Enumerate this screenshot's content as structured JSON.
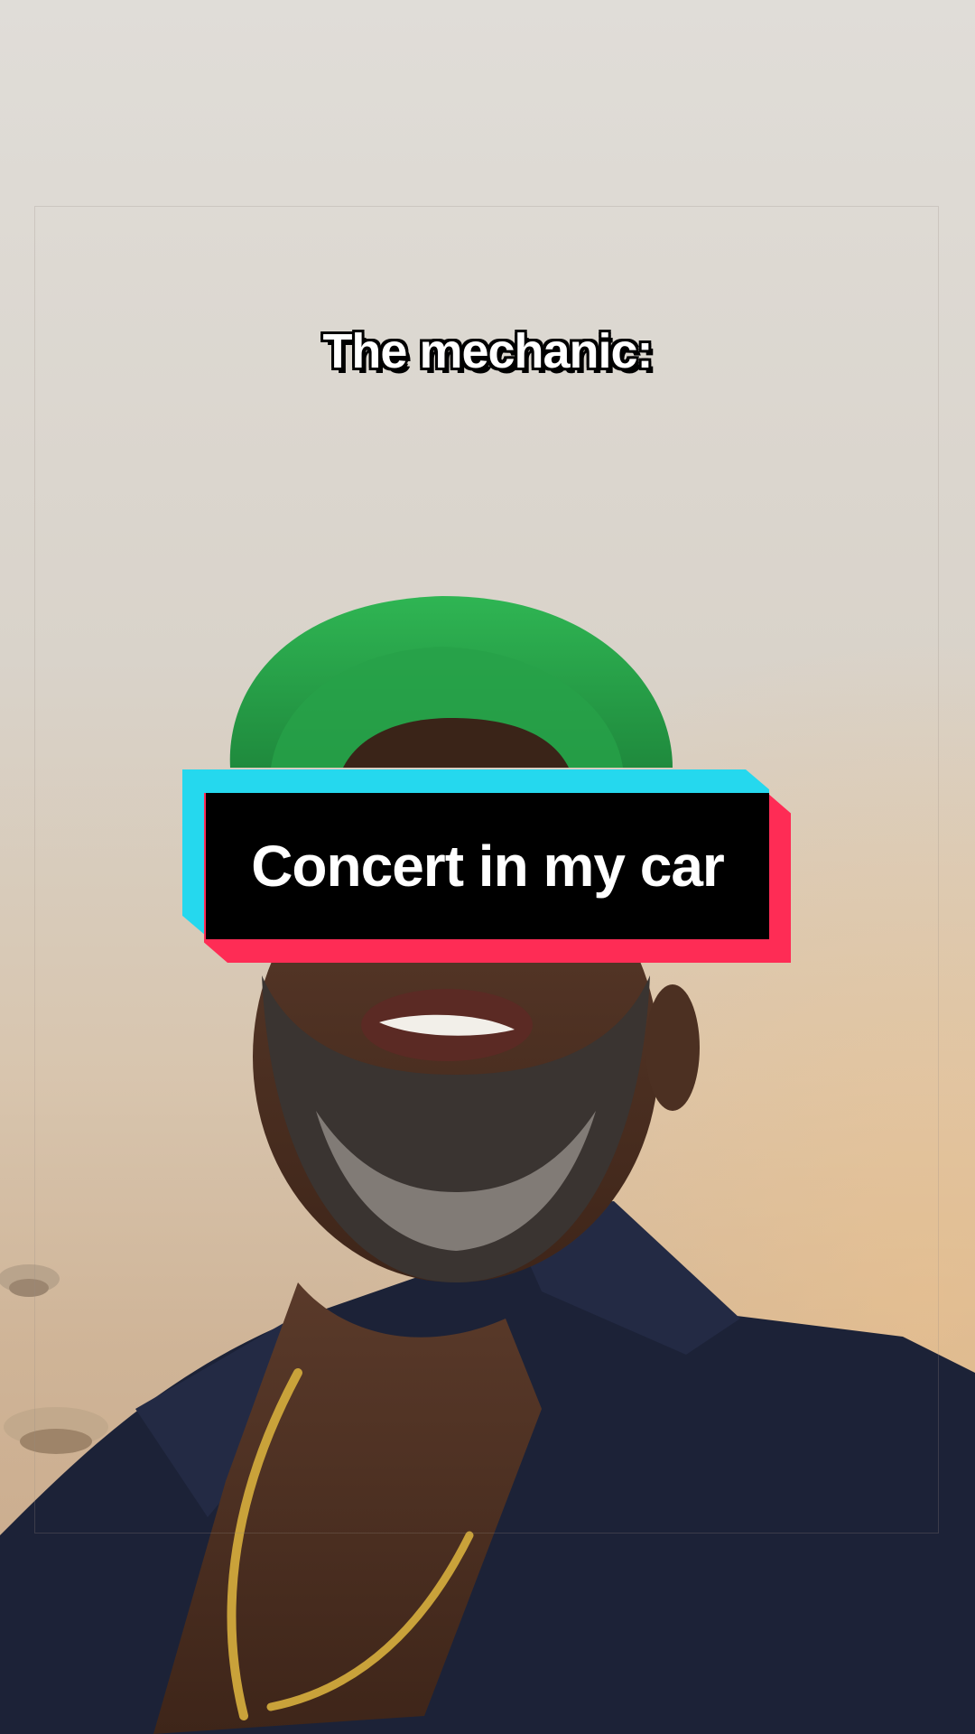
{
  "overlay": {
    "top_caption": "The mechanic:",
    "banner_caption": "Concert in my car"
  },
  "colors": {
    "banner_cyan": "#25d8ee",
    "banner_red": "#fe2c55",
    "banner_black": "#000000",
    "cap_green": "#2aa64a",
    "shirt_navy": "#1c2237",
    "chain_gold": "#c9a23a"
  },
  "icons": {
    "ceiling_lamp": "ceiling-lamp-icon"
  }
}
